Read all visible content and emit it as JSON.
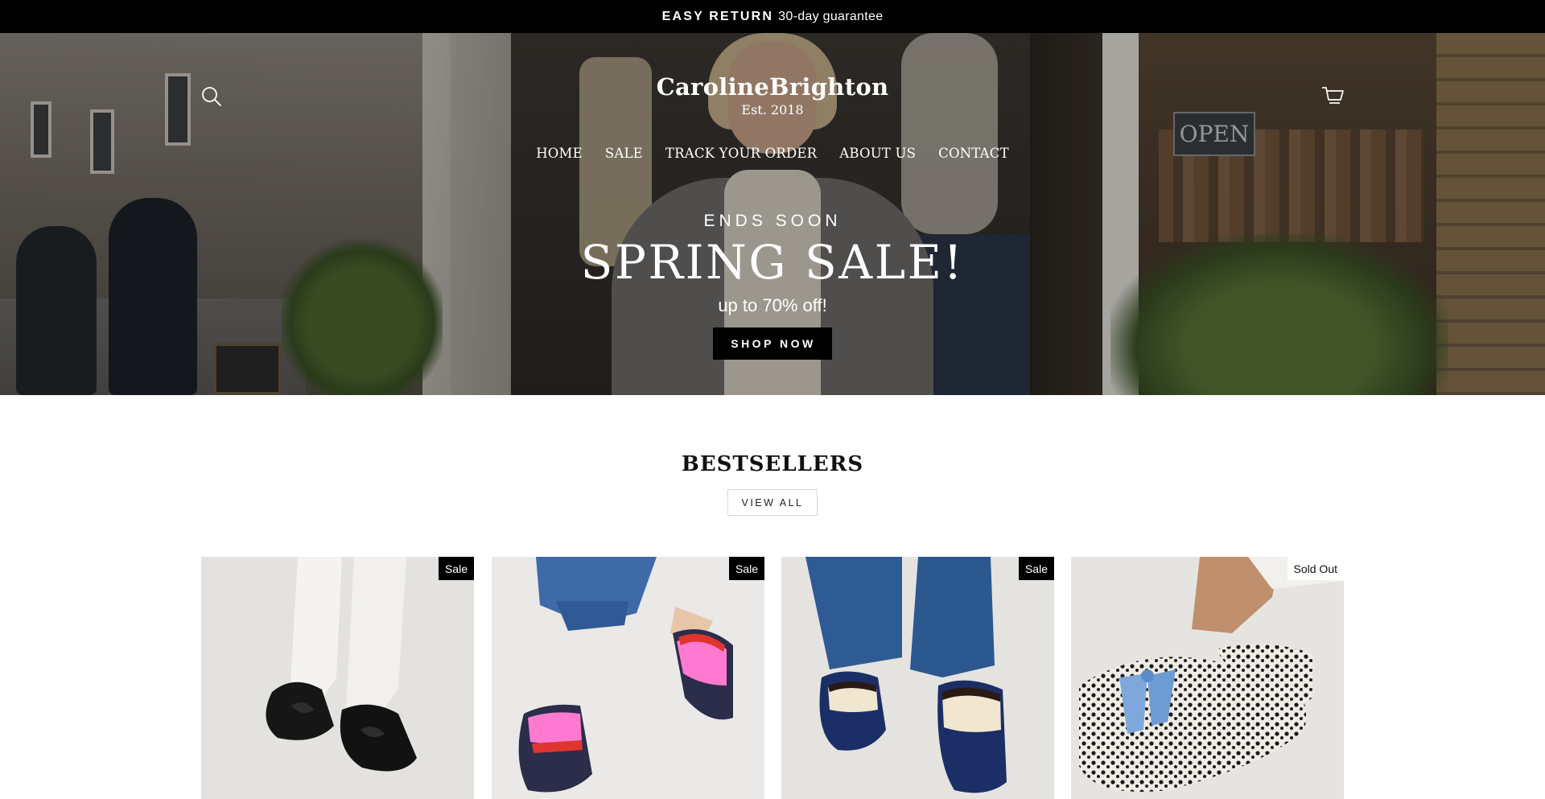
{
  "announcement": {
    "strong": "EASY RETURN",
    "text": "30-day guarantee"
  },
  "header": {
    "brand_name": "CarolineBrighton",
    "brand_tagline": "Est. 2018",
    "search_icon": "search-icon",
    "cart_icon": "cart-icon"
  },
  "nav": {
    "items": [
      {
        "label": "HOME"
      },
      {
        "label": "SALE"
      },
      {
        "label": "TRACK YOUR ORDER"
      },
      {
        "label": "ABOUT US"
      },
      {
        "label": "CONTACT"
      }
    ]
  },
  "hero": {
    "kicker": "ENDS SOON",
    "headline": "SPRING SALE!",
    "subtext": "up to 70% off!",
    "cta": "SHOP NOW",
    "sign_text": "OPEN"
  },
  "bestsellers": {
    "title": "BESTSELLERS",
    "view_all": "VIEW ALL",
    "products": [
      {
        "badge": "Sale"
      },
      {
        "badge": "Sale"
      },
      {
        "badge": "Sale"
      },
      {
        "badge": "Sold Out"
      }
    ]
  },
  "colors": {
    "announcement_bg": "#000000",
    "cta_bg": "#000000",
    "badge_sale_bg": "#000000",
    "badge_soldout_bg": "#ffffff"
  }
}
